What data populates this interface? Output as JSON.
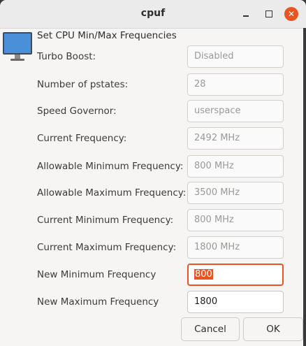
{
  "window": {
    "title": "cpuf",
    "controls": {
      "minimize_icon": "minimize-icon",
      "maximize_icon": "maximize-icon",
      "close_icon": "close-icon"
    }
  },
  "header": {
    "icon": "monitor-icon",
    "heading": "Set CPU Min/Max Frequencies"
  },
  "fields": [
    {
      "label": "Turbo Boost:",
      "value": "Disabled"
    },
    {
      "label": "Number of pstates:",
      "value": "28"
    },
    {
      "label": "Speed Governor:",
      "value": "userspace"
    },
    {
      "label": "Current Frequency:",
      "value": "2492 MHz"
    },
    {
      "label": "Allowable Minimum Frequency:",
      "value": "800 MHz"
    },
    {
      "label": "Allowable Maximum Frequency:",
      "value": "3500 MHz"
    },
    {
      "label": "Current Minimum Frequency:",
      "value": "800 MHz"
    },
    {
      "label": "Current Maximum Frequency:",
      "value": "1800 MHz"
    },
    {
      "label": "New Minimum Frequency",
      "value": "800"
    },
    {
      "label": "New Maximum Frequency",
      "value": "1800"
    }
  ],
  "buttons": {
    "cancel": "Cancel",
    "ok": "OK"
  },
  "colors": {
    "accent": "#e95420",
    "window_bg": "#f6f5f4"
  }
}
